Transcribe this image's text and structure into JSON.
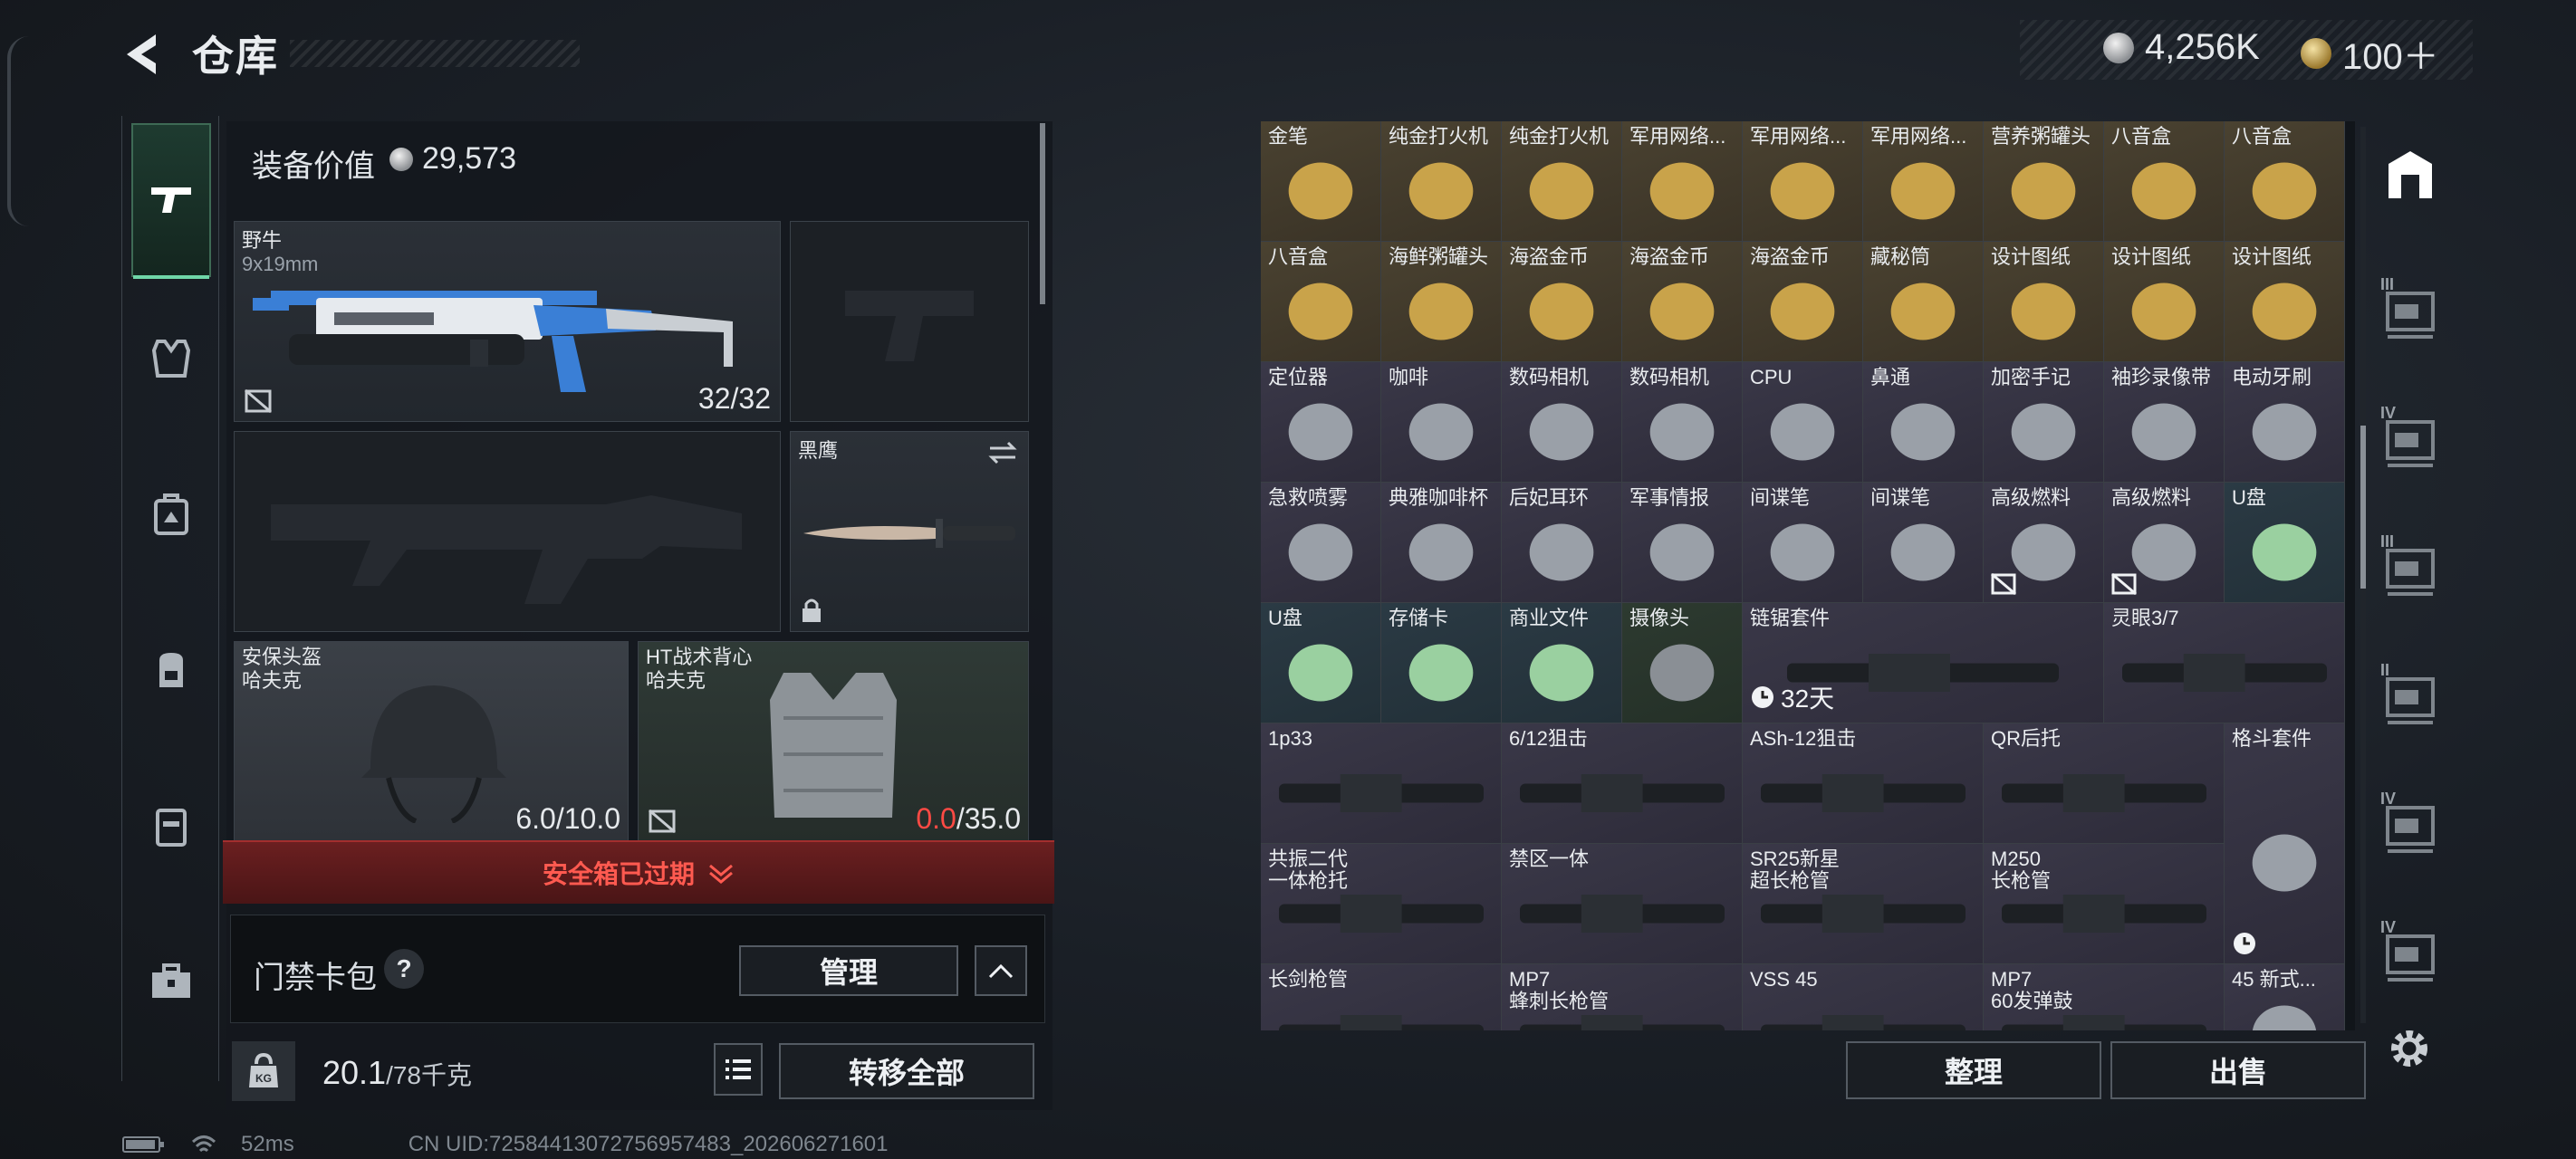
{
  "header": {
    "title": "仓库",
    "currency_silver": "4,256K",
    "currency_gold": "100＋"
  },
  "loadout": {
    "equip_value_label": "装备价值",
    "equip_value": "29,573",
    "primary": {
      "name": "野牛",
      "ammo": "9x19mm",
      "count": "32/32"
    },
    "melee": {
      "name": "黑鹰"
    },
    "helmet": {
      "name": "安保头盔",
      "brand": "哈夫克",
      "durability": "6.0/10.0"
    },
    "vest": {
      "name": "HT战术背心",
      "brand": "哈夫克",
      "durability_current": "0.0",
      "durability_max": "/35.0"
    },
    "safebox": "安全箱已过期",
    "keycard_label": "门禁卡包",
    "keycard_help": "?",
    "manage": "管理",
    "weight": "20.1",
    "weight_max": "/78千克",
    "transfer_all": "转移全部"
  },
  "status": {
    "ping": "52ms",
    "uid": "CN UID:72584413072756957483_202606271601"
  },
  "inventory": {
    "items": [
      {
        "name": "金笔",
        "grade": "gold"
      },
      {
        "name": "纯金打火机",
        "grade": "gold"
      },
      {
        "name": "纯金打火机",
        "grade": "gold"
      },
      {
        "name": "军用网络...",
        "grade": "gold"
      },
      {
        "name": "军用网络...",
        "grade": "gold"
      },
      {
        "name": "军用网络...",
        "grade": "gold"
      },
      {
        "name": "营养粥罐头",
        "grade": "gold"
      },
      {
        "name": "八音盒",
        "grade": "gold"
      },
      {
        "name": "八音盒",
        "grade": "gold"
      },
      {
        "name": "八音盒",
        "grade": "gold"
      },
      {
        "name": "海鲜粥罐头",
        "grade": "gold"
      },
      {
        "name": "海盗金币",
        "grade": "gold"
      },
      {
        "name": "海盗金币",
        "grade": "gold"
      },
      {
        "name": "海盗金币",
        "grade": "gold"
      },
      {
        "name": "藏秘筒",
        "grade": "gold"
      },
      {
        "name": "设计图纸",
        "grade": "gold"
      },
      {
        "name": "设计图纸",
        "grade": "gold"
      },
      {
        "name": "设计图纸",
        "grade": "gold"
      },
      {
        "name": "定位器",
        "grade": "purple"
      },
      {
        "name": "咖啡",
        "grade": "purple"
      },
      {
        "name": "数码相机",
        "grade": "purple"
      },
      {
        "name": "数码相机",
        "grade": "purple"
      },
      {
        "name": "CPU",
        "grade": "purple"
      },
      {
        "name": "鼻通",
        "grade": "purple"
      },
      {
        "name": "加密手记",
        "grade": "purple"
      },
      {
        "name": "袖珍录像带",
        "grade": "purple"
      },
      {
        "name": "电动牙刷",
        "grade": "purple"
      },
      {
        "name": "急救喷雾",
        "grade": "purple"
      },
      {
        "name": "典雅咖啡杯",
        "grade": "purple"
      },
      {
        "name": "后妃耳环",
        "grade": "purple"
      },
      {
        "name": "军事情报",
        "grade": "purple"
      },
      {
        "name": "间谍笔",
        "grade": "purple"
      },
      {
        "name": "间谍笔",
        "grade": "purple"
      },
      {
        "name": "高级燃料",
        "grade": "purple"
      },
      {
        "name": "高级燃料",
        "grade": "purple"
      },
      {
        "name": "U盘",
        "grade": "blue"
      },
      {
        "name": "U盘",
        "grade": "blue"
      },
      {
        "name": "存储卡",
        "grade": "blue"
      },
      {
        "name": "商业文件",
        "grade": "blue"
      },
      {
        "name": "摄像头",
        "grade": "green"
      },
      {
        "name": "链锯套件",
        "grade": "purple",
        "badge": "32天"
      },
      {
        "name": "灵眼3/7",
        "grade": "purple"
      },
      {
        "name": "1p33",
        "grade": "purple"
      },
      {
        "name": "6/12狙击",
        "grade": "purple"
      },
      {
        "name": "ASh-12狙击",
        "grade": "purple"
      },
      {
        "name": "QR后托",
        "grade": "purple"
      },
      {
        "name": "格斗套件",
        "grade": "purple"
      },
      {
        "name": "共振二代",
        "sub": "一体枪托",
        "grade": "purple"
      },
      {
        "name": "禁区一体",
        "grade": "purple"
      },
      {
        "name": "SR25新星",
        "sub": "超长枪管",
        "grade": "purple"
      },
      {
        "name": "M250",
        "sub": "长枪管",
        "grade": "purple"
      },
      {
        "name": "长剑枪管",
        "grade": "purple"
      },
      {
        "name": "MP7",
        "sub": "蜂刺长枪管",
        "grade": "purple"
      },
      {
        "name": "VSS 45",
        "grade": "purple"
      },
      {
        "name": "MP7",
        "sub": "60发弹鼓",
        "grade": "purple"
      },
      {
        "name": "45 新式...",
        "grade": "purple"
      }
    ],
    "sort": "整理",
    "sell": "出售"
  },
  "rightbar": {
    "tier_labels": [
      "III",
      "IV",
      "III",
      "II",
      "IV",
      "IV"
    ]
  }
}
